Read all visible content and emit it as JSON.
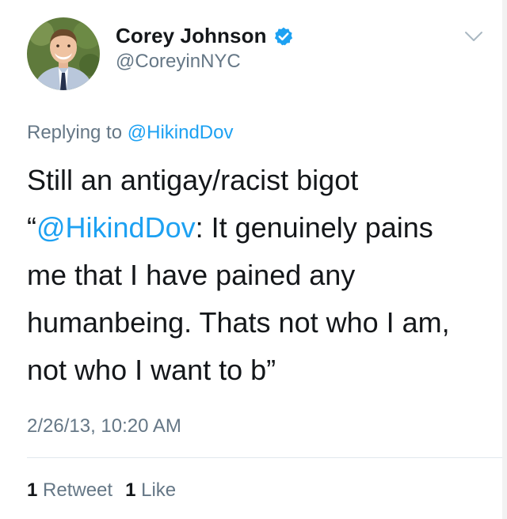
{
  "author": {
    "display_name": "Corey Johnson",
    "handle": "@CoreyinNYC",
    "verified": true
  },
  "reply": {
    "prefix": "Replying to",
    "mention": "@HikindDov"
  },
  "tweet": {
    "line1": "Still an antigay/racist bigot",
    "line2_quote_open": "“",
    "line2_mention": "@HikindDov",
    "line2_rest": ": It genuinely pains",
    "line3": "me that I have pained any",
    "line4": "humanbeing. Thats not who I am,",
    "line5": "not who I want to b”"
  },
  "timestamp": "2/26/13, 10:20 AM",
  "stats": {
    "retweets_count": "1",
    "retweets_label": "Retweet",
    "likes_count": "1",
    "likes_label": "Like"
  },
  "colors": {
    "link": "#1da1f2",
    "secondary_text": "#657786",
    "primary_text": "#14171a",
    "divider": "#e1e8ed"
  },
  "icons": {
    "verified": "verified-badge-icon",
    "caret": "chevron-down-icon"
  }
}
